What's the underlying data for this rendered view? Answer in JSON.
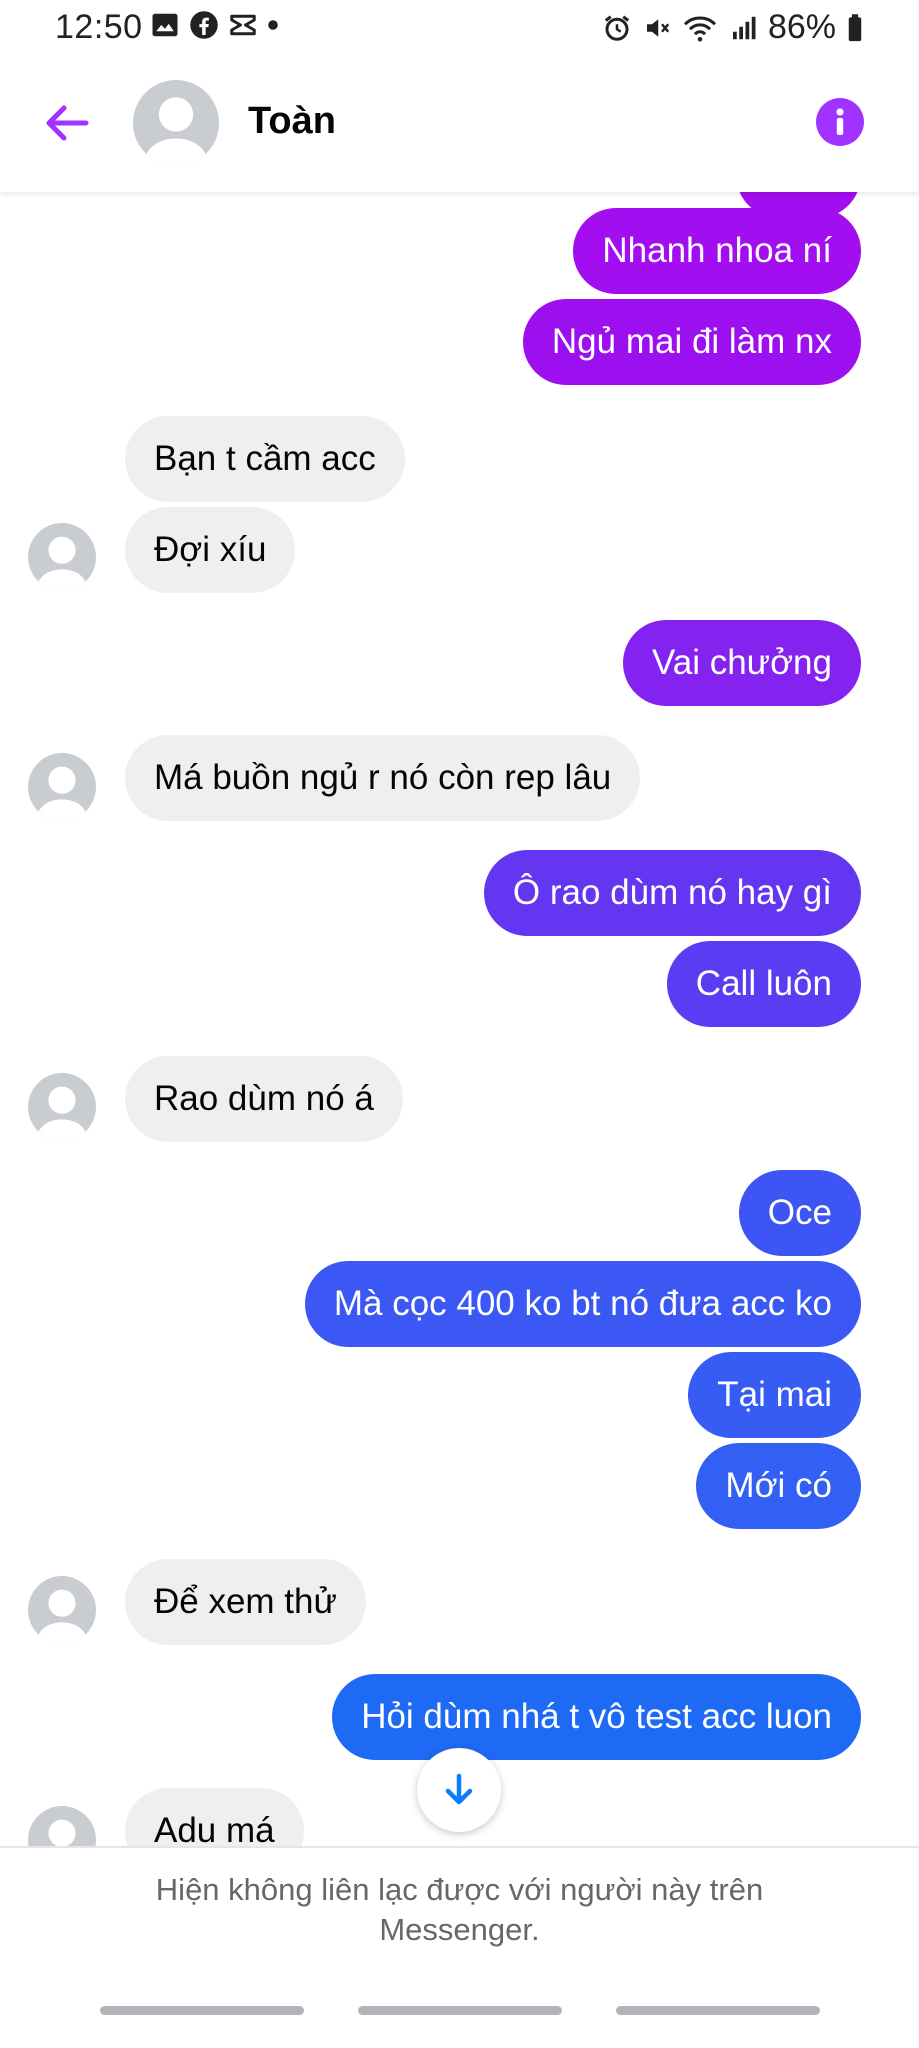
{
  "status_bar": {
    "time": "12:50",
    "battery": "86%",
    "icons_left": [
      "gallery-icon",
      "facebook-icon",
      "capcut-icon",
      "dot-icon"
    ],
    "icons_right": [
      "alarm-icon",
      "mute-icon",
      "wifi-icon",
      "signal-icon",
      "battery-icon"
    ]
  },
  "header": {
    "contact_name": "Toàn",
    "accent_color": "#a033ff"
  },
  "messages": {
    "outgoing": [
      "Nhanh nhoa ní",
      "Ngủ mai đi làm nx",
      "Vai chưởng",
      "Ô rao dùm nó hay gì",
      "Call luôn",
      "Oce",
      "Mà cọc 400 ko bt nó đưa acc ko",
      "Tại mai",
      "Mới có",
      "Hỏi dùm nhá t vô test acc luon"
    ],
    "incoming": [
      "Bạn t cầm acc",
      "Đợi xíu",
      "Má buồn ngủ r nó còn rep lâu",
      "Rao dùm nó á",
      "Để xem thử",
      "Adu má"
    ]
  },
  "gradient_colors": [
    "#a20ef0",
    "#1e6af5"
  ],
  "footer": {
    "notice_line1": "Hiện không liên lạc được với người này trên",
    "notice_line2": "Messenger."
  }
}
